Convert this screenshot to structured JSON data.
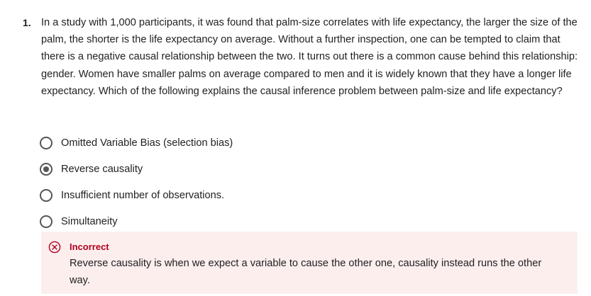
{
  "question": {
    "number": "1.",
    "text": "In a study with 1,000 participants, it was found that palm-size correlates with life expectancy, the larger the size of the palm, the shorter is the life expectancy on average. Without a further inspection, one can be tempted to claim that there is a negative causal relationship between the two. It turns out there is a common cause behind this relationship: gender. Women have smaller palms on average compared to men and it is widely known that they have a longer life expectancy. Which of the following explains the causal inference problem between palm-size and life expectancy?"
  },
  "options": [
    {
      "label": "Omitted Variable Bias (selection bias)",
      "selected": false
    },
    {
      "label": "Reverse causality",
      "selected": true
    },
    {
      "label": "Insufficient number of observations.",
      "selected": false
    },
    {
      "label": "Simultaneity",
      "selected": false
    }
  ],
  "feedback": {
    "status": "Incorrect",
    "icon": "x-circle-icon",
    "color": "#b00020",
    "background": "#fdeeee",
    "explanation": "Reverse causality is when we expect a variable to cause the other one, causality instead runs the other way."
  }
}
